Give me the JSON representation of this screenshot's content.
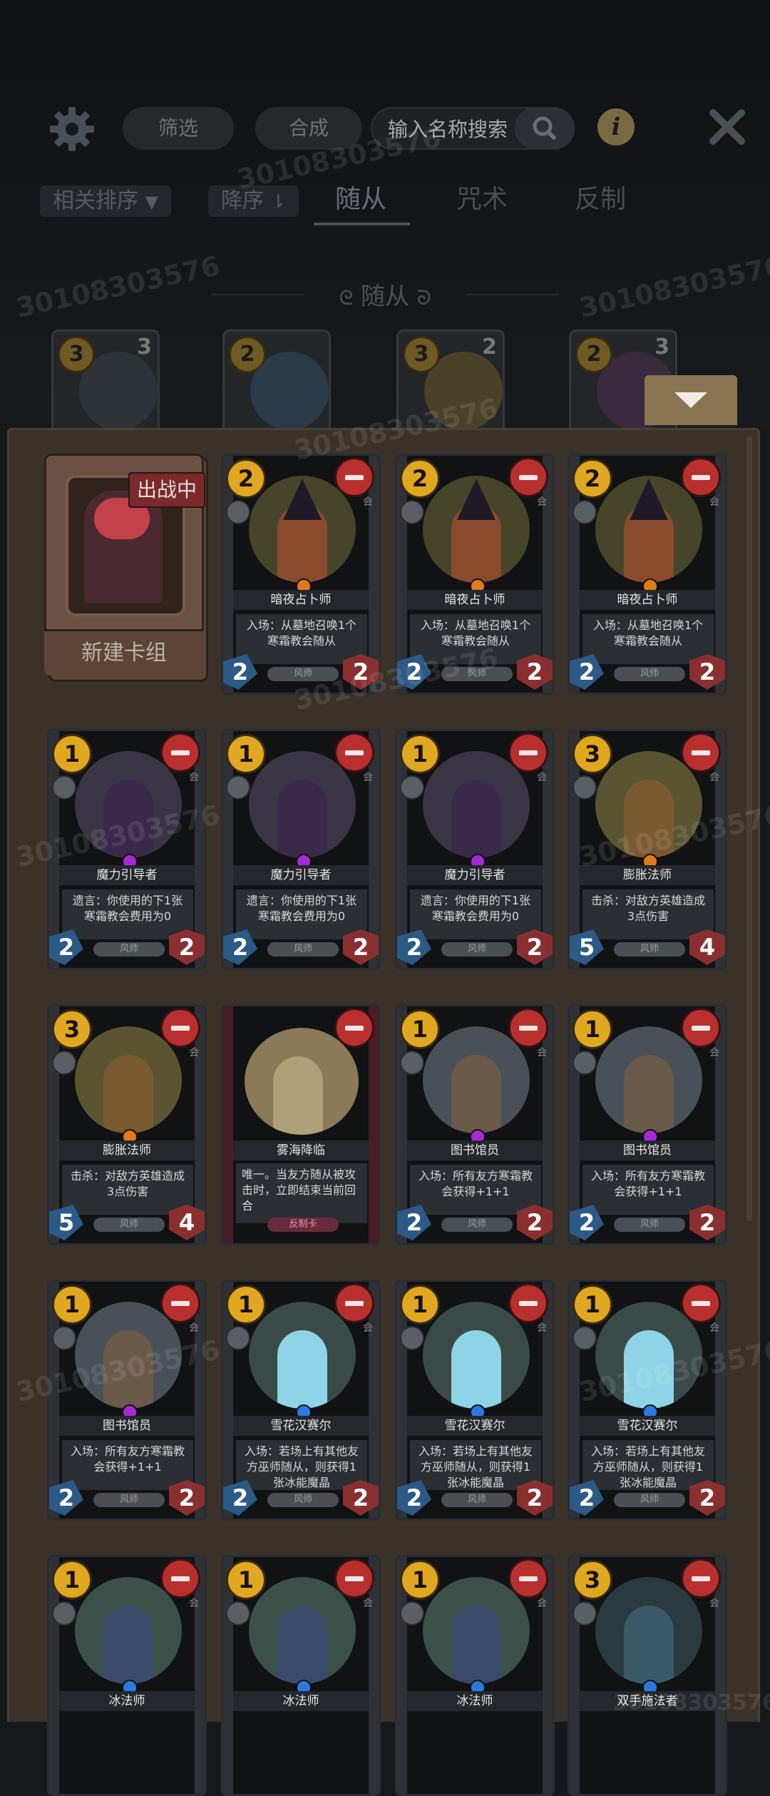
{
  "toolbar": {
    "filter_label": "筛选",
    "craft_label": "合成",
    "search_placeholder": "输入名称搜索",
    "info_label": "i"
  },
  "filters": {
    "sort_label": "相关排序",
    "order_label": "降序",
    "tabs": [
      "随从",
      "咒术",
      "反制"
    ],
    "active_tab": "随从"
  },
  "section_title": "随从",
  "bg_cards": [
    {
      "cost": "3",
      "num": "3"
    },
    {
      "cost": "2",
      "num": ""
    },
    {
      "cost": "3",
      "num": "2"
    },
    {
      "cost": "2",
      "num": "3"
    }
  ],
  "new_deck": {
    "badge": "出战中",
    "label": "新建卡组"
  },
  "cards": [
    {
      "name": "暗夜占卜师",
      "cost": "2",
      "attack": "2",
      "health": "2",
      "desc": "入场：从墓地召唤1个寒霜教会随从",
      "type": "风师"
    },
    {
      "name": "暗夜占卜师",
      "cost": "2",
      "attack": "2",
      "health": "2",
      "desc": "入场：从墓地召唤1个寒霜教会随从",
      "type": "风师"
    },
    {
      "name": "暗夜占卜师",
      "cost": "2",
      "attack": "2",
      "health": "2",
      "desc": "入场：从墓地召唤1个寒霜教会随从",
      "type": "风师"
    },
    {
      "name": "魔力引导者",
      "cost": "1",
      "attack": "2",
      "health": "2",
      "desc": "遗言：你使用的下1张寒霜教会费用为0",
      "type": "风师"
    },
    {
      "name": "魔力引导者",
      "cost": "1",
      "attack": "2",
      "health": "2",
      "desc": "遗言：你使用的下1张寒霜教会费用为0",
      "type": "风师"
    },
    {
      "name": "魔力引导者",
      "cost": "1",
      "attack": "2",
      "health": "2",
      "desc": "遗言：你使用的下1张寒霜教会费用为0",
      "type": "风师"
    },
    {
      "name": "膨胀法师",
      "cost": "3",
      "attack": "5",
      "health": "4",
      "desc": "击杀：对敌方英雄造成3点伤害",
      "type": "风师"
    },
    {
      "name": "膨胀法师",
      "cost": "3",
      "attack": "5",
      "health": "4",
      "desc": "击杀：对敌方英雄造成3点伤害",
      "type": "风师"
    },
    {
      "name": "雾海降临",
      "cost": "",
      "attack": "",
      "health": "",
      "desc": "唯一。当友方随从被攻击时，立即结束当前回合",
      "type": "反制卡"
    },
    {
      "name": "图书馆员",
      "cost": "1",
      "attack": "2",
      "health": "2",
      "desc": "入场：所有友方寒霜教会获得+1+1",
      "type": "风师"
    },
    {
      "name": "图书馆员",
      "cost": "1",
      "attack": "2",
      "health": "2",
      "desc": "入场：所有友方寒霜教会获得+1+1",
      "type": "风师"
    },
    {
      "name": "图书馆员",
      "cost": "1",
      "attack": "2",
      "health": "2",
      "desc": "入场：所有友方寒霜教会获得+1+1",
      "type": "风师"
    },
    {
      "name": "雪花汉赛尔",
      "cost": "1",
      "attack": "2",
      "health": "2",
      "desc": "入场：若场上有其他友方巫师随从，则获得1张冰能魔晶",
      "type": "风师"
    },
    {
      "name": "雪花汉赛尔",
      "cost": "1",
      "attack": "2",
      "health": "2",
      "desc": "入场：若场上有其他友方巫师随从，则获得1张冰能魔晶",
      "type": "风师"
    },
    {
      "name": "雪花汉赛尔",
      "cost": "1",
      "attack": "2",
      "health": "2",
      "desc": "入场：若场上有其他友方巫师随从，则获得1张冰能魔晶",
      "type": "风师"
    },
    {
      "name": "冰法师",
      "cost": "1",
      "attack": "",
      "health": "",
      "desc": "",
      "type": ""
    },
    {
      "name": "冰法师",
      "cost": "1",
      "attack": "",
      "health": "",
      "desc": "",
      "type": ""
    },
    {
      "name": "冰法师",
      "cost": "1",
      "attack": "",
      "health": "",
      "desc": "",
      "type": ""
    },
    {
      "name": "双手施法者",
      "cost": "3",
      "attack": "",
      "health": "",
      "desc": "",
      "type": ""
    }
  ],
  "card_hui": "会",
  "watermark": "30108303576",
  "colors": {
    "accent_gold": "#e0a821",
    "remove_red": "#b8302e",
    "keyword_yellow": "#e5c25b",
    "keyword_teal": "#5fd3c6",
    "panel_brown": "#3a3229"
  }
}
